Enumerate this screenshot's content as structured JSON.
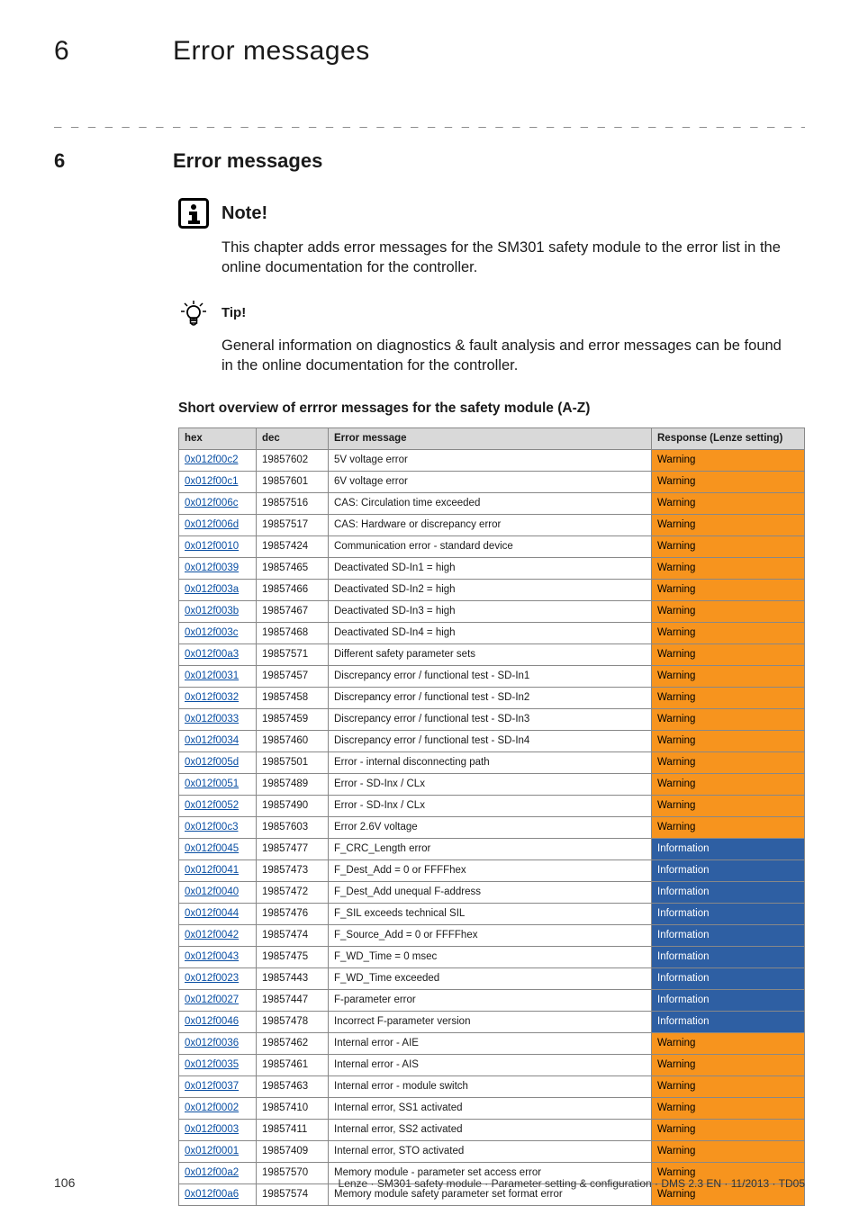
{
  "header": {
    "number": "6",
    "title": "Error messages"
  },
  "dashes": "_ _ _ _ _ _ _ _ _ _ _ _ _ _ _ _ _ _ _ _ _ _ _ _ _ _ _ _ _ _ _ _ _ _ _ _ _ _ _ _ _ _ _ _ _ _ _ _ _ _ _ _ _ _ _ _ _ _ _ _ _ _ _ _",
  "section": {
    "number": "6",
    "title": "Error messages"
  },
  "note": {
    "title": "Note!",
    "body": "This chapter adds error messages for the SM301 safety module to the error list in the online documentation for the controller."
  },
  "tip": {
    "title": "Tip!",
    "body": "General information on diagnostics & fault analysis and error messages can be found in the online documentation for the controller."
  },
  "table_title": "Short overview of errror messages for the safety module (A-Z)",
  "table_headers": {
    "hex": "hex",
    "dec": "dec",
    "msg": "Error message",
    "rsp": "Response (Lenze setting)"
  },
  "rows": [
    {
      "hex": "0x012f00c2",
      "dec": "19857602",
      "msg": "5V voltage error",
      "rsp": "Warning"
    },
    {
      "hex": "0x012f00c1",
      "dec": "19857601",
      "msg": "6V voltage error",
      "rsp": "Warning"
    },
    {
      "hex": "0x012f006c",
      "dec": "19857516",
      "msg": "CAS: Circulation time exceeded",
      "rsp": "Warning"
    },
    {
      "hex": "0x012f006d",
      "dec": "19857517",
      "msg": "CAS: Hardware or discrepancy error",
      "rsp": "Warning"
    },
    {
      "hex": "0x012f0010",
      "dec": "19857424",
      "msg": "Communication error - standard device",
      "rsp": "Warning"
    },
    {
      "hex": "0x012f0039",
      "dec": "19857465",
      "msg": "Deactivated SD-In1 = high",
      "rsp": "Warning"
    },
    {
      "hex": "0x012f003a",
      "dec": "19857466",
      "msg": "Deactivated SD-In2 = high",
      "rsp": "Warning"
    },
    {
      "hex": "0x012f003b",
      "dec": "19857467",
      "msg": "Deactivated SD-In3 = high",
      "rsp": "Warning"
    },
    {
      "hex": "0x012f003c",
      "dec": "19857468",
      "msg": "Deactivated SD-In4 = high",
      "rsp": "Warning"
    },
    {
      "hex": "0x012f00a3",
      "dec": "19857571",
      "msg": "Different safety parameter sets",
      "rsp": "Warning"
    },
    {
      "hex": "0x012f0031",
      "dec": "19857457",
      "msg": "Discrepancy error / functional test - SD-In1",
      "rsp": "Warning"
    },
    {
      "hex": "0x012f0032",
      "dec": "19857458",
      "msg": "Discrepancy error / functional test - SD-In2",
      "rsp": "Warning"
    },
    {
      "hex": "0x012f0033",
      "dec": "19857459",
      "msg": "Discrepancy error / functional test - SD-In3",
      "rsp": "Warning"
    },
    {
      "hex": "0x012f0034",
      "dec": "19857460",
      "msg": "Discrepancy error / functional test - SD-In4",
      "rsp": "Warning"
    },
    {
      "hex": "0x012f005d",
      "dec": "19857501",
      "msg": "Error - internal disconnecting path",
      "rsp": "Warning"
    },
    {
      "hex": "0x012f0051",
      "dec": "19857489",
      "msg": "Error - SD-Inx / CLx",
      "rsp": "Warning"
    },
    {
      "hex": "0x012f0052",
      "dec": "19857490",
      "msg": "Error - SD-Inx / CLx",
      "rsp": "Warning"
    },
    {
      "hex": "0x012f00c3",
      "dec": "19857603",
      "msg": "Error 2.6V voltage",
      "rsp": "Warning"
    },
    {
      "hex": "0x012f0045",
      "dec": "19857477",
      "msg": "F_CRC_Length error",
      "rsp": "Information"
    },
    {
      "hex": "0x012f0041",
      "dec": "19857473",
      "msg": "F_Dest_Add = 0 or FFFFhex",
      "rsp": "Information"
    },
    {
      "hex": "0x012f0040",
      "dec": "19857472",
      "msg": "F_Dest_Add unequal F-address",
      "rsp": "Information"
    },
    {
      "hex": "0x012f0044",
      "dec": "19857476",
      "msg": "F_SIL exceeds technical SIL",
      "rsp": "Information"
    },
    {
      "hex": "0x012f0042",
      "dec": "19857474",
      "msg": "F_Source_Add = 0 or FFFFhex",
      "rsp": "Information"
    },
    {
      "hex": "0x012f0043",
      "dec": "19857475",
      "msg": "F_WD_Time = 0 msec",
      "rsp": "Information"
    },
    {
      "hex": "0x012f0023",
      "dec": "19857443",
      "msg": "F_WD_Time exceeded",
      "rsp": "Information"
    },
    {
      "hex": "0x012f0027",
      "dec": "19857447",
      "msg": "F-parameter error",
      "rsp": "Information"
    },
    {
      "hex": "0x012f0046",
      "dec": "19857478",
      "msg": "Incorrect F-parameter version",
      "rsp": "Information"
    },
    {
      "hex": "0x012f0036",
      "dec": "19857462",
      "msg": "Internal error - AIE",
      "rsp": "Warning"
    },
    {
      "hex": "0x012f0035",
      "dec": "19857461",
      "msg": "Internal error - AIS",
      "rsp": "Warning"
    },
    {
      "hex": "0x012f0037",
      "dec": "19857463",
      "msg": "Internal error - module switch",
      "rsp": "Warning"
    },
    {
      "hex": "0x012f0002",
      "dec": "19857410",
      "msg": "Internal error, SS1 activated",
      "rsp": "Warning"
    },
    {
      "hex": "0x012f0003",
      "dec": "19857411",
      "msg": "Internal error, SS2 activated",
      "rsp": "Warning"
    },
    {
      "hex": "0x012f0001",
      "dec": "19857409",
      "msg": "Internal error, STO activated",
      "rsp": "Warning"
    },
    {
      "hex": "0x012f00a2",
      "dec": "19857570",
      "msg": "Memory module - parameter set access error",
      "rsp": "Warning"
    },
    {
      "hex": "0x012f00a6",
      "dec": "19857574",
      "msg": "Memory module safety parameter set format error",
      "rsp": "Warning"
    }
  ],
  "footer": {
    "page": "106",
    "text": "Lenze · SM301 safety module · Parameter setting & configuration · DMS 2.3 EN · 11/2013 · TD05"
  }
}
